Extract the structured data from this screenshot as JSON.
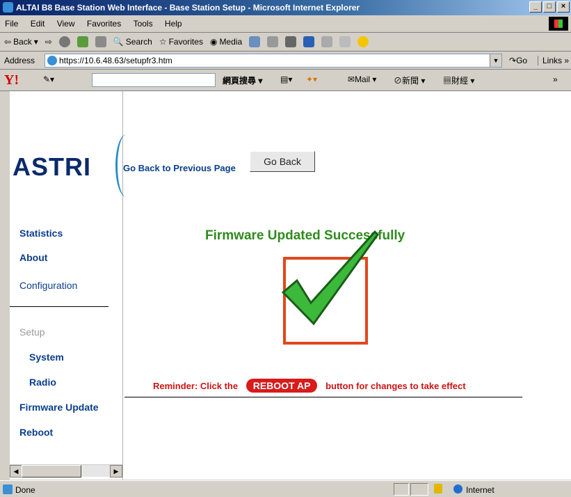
{
  "window": {
    "title": "ALTAI B8 Base Station Web Interface - Base Station Setup - Microsoft Internet Explorer"
  },
  "menu": [
    "File",
    "Edit",
    "View",
    "Favorites",
    "Tools",
    "Help"
  ],
  "toolbar": {
    "back": "Back",
    "search": "Search",
    "favorites": "Favorites",
    "media": "Media"
  },
  "address": {
    "label": "Address",
    "url": "https://10.6.48.63/setupfr3.htm",
    "go": "Go",
    "links": "Links"
  },
  "yahoo": {
    "logo": "Y!",
    "search_button": "網頁搜尋",
    "mail": "Mail",
    "news": "新聞",
    "finance": "財經"
  },
  "sidebar": {
    "logo": "ASTRI",
    "items": [
      "Statistics",
      "About",
      "Configuration",
      "Setup",
      "System",
      "Radio",
      "Firmware Update",
      "Reboot"
    ]
  },
  "main": {
    "go_back_text": "Go Back to Previous Page",
    "go_back_button": "Go Back",
    "success_message": "Firmware Updated Successfully",
    "reminder_prefix": "Reminder: Click the",
    "reboot_label": "REBOOT AP",
    "reminder_suffix": "button for changes to take effect"
  },
  "status": {
    "text": "Done",
    "zone": "Internet"
  },
  "colors": {
    "success": "#2e8b1c",
    "reminder": "#cc1414",
    "check_border": "#e2471b",
    "nav": "#0b3e8c"
  }
}
